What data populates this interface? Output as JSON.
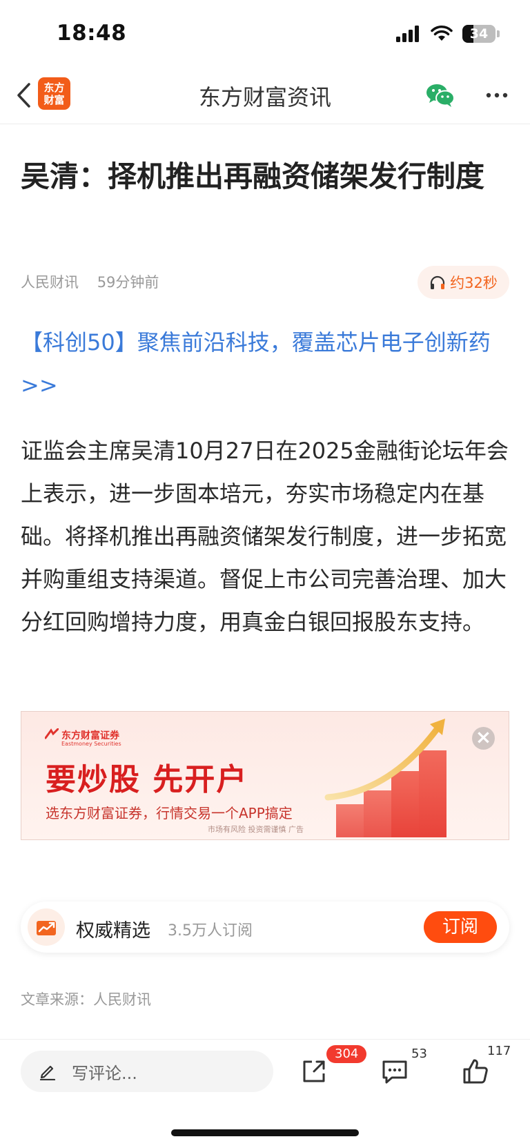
{
  "status": {
    "time": "18:48",
    "battery": "34"
  },
  "nav": {
    "logo_line1": "东方",
    "logo_line2": "财富",
    "title": "东方财富资讯"
  },
  "article": {
    "title": "吴清：择机推出再融资储架发行制度",
    "source": "人民财讯",
    "time_ago": "59分钟前",
    "listen_label": "约32秒",
    "promo_link": "【科创50】聚焦前沿科技，覆盖芯片电子创新药>>",
    "body": "证监会主席吴清10月27日在2025金融街论坛年会上表示，进一步固本培元，夯实市场稳定内在基础。将择机推出再融资储架发行制度，进一步拓宽并购重组支持渠道。督促上市公司完善治理、加大分红回购增持力度，用真金白银回报股东支持。",
    "source_line": "文章来源：人民财讯"
  },
  "ad": {
    "brand": "东方财富证券",
    "brand_en": "Eastmoney Securities",
    "headline": "要炒股  先开户",
    "subline": "选东方财富证券，行情交易一个APP搞定",
    "disclaimer": "市场有风险 投资需谨慎  广告"
  },
  "subscription": {
    "name": "权威精选",
    "count": "3.5万人订阅",
    "button": "订阅"
  },
  "bottom": {
    "comment_placeholder": "写评论...",
    "share_count": "304",
    "comment_count": "53",
    "like_count": "117"
  },
  "colors": {
    "accent": "#f25c19",
    "link": "#3a7ad9",
    "subscribe": "#ff4c0f",
    "badge": "#f23a2e"
  }
}
